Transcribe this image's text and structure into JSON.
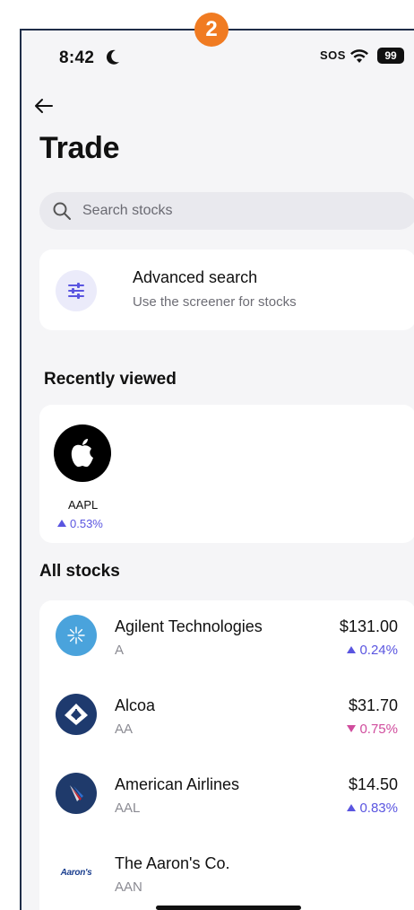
{
  "step_badge": "2",
  "status_bar": {
    "time": "8:42",
    "sos": "SOS",
    "battery": "99",
    "moon_icon": "moon-icon",
    "wifi_icon": "wifi-icon"
  },
  "header": {
    "back_icon": "arrow-left-icon",
    "title": "Trade"
  },
  "search": {
    "placeholder": "Search stocks",
    "value": "",
    "icon": "search-icon"
  },
  "advanced_search": {
    "title": "Advanced search",
    "subtitle": "Use the screener for stocks",
    "icon": "sliders-icon"
  },
  "recently_viewed": {
    "title": "Recently viewed",
    "items": [
      {
        "ticker": "AAPL",
        "change": "0.53%",
        "direction": "up",
        "logo": "apple-logo"
      }
    ]
  },
  "all_stocks": {
    "title": "All stocks",
    "items": [
      {
        "name": "Agilent Technologies",
        "ticker": "A",
        "price": "$131.00",
        "change": "0.24%",
        "direction": "up"
      },
      {
        "name": "Alcoa",
        "ticker": "AA",
        "price": "$31.70",
        "change": "0.75%",
        "direction": "down"
      },
      {
        "name": "American Airlines",
        "ticker": "AAL",
        "price": "$14.50",
        "change": "0.83%",
        "direction": "up"
      },
      {
        "name": "The Aaron's Co.",
        "ticker": "AAN",
        "price": "",
        "change": "",
        "direction": "",
        "logo_text": "Aaron's"
      }
    ]
  },
  "colors": {
    "accent": "#5a55e0",
    "negative": "#d04c9d",
    "badge": "#f07b22",
    "background": "#f5f5f7"
  }
}
